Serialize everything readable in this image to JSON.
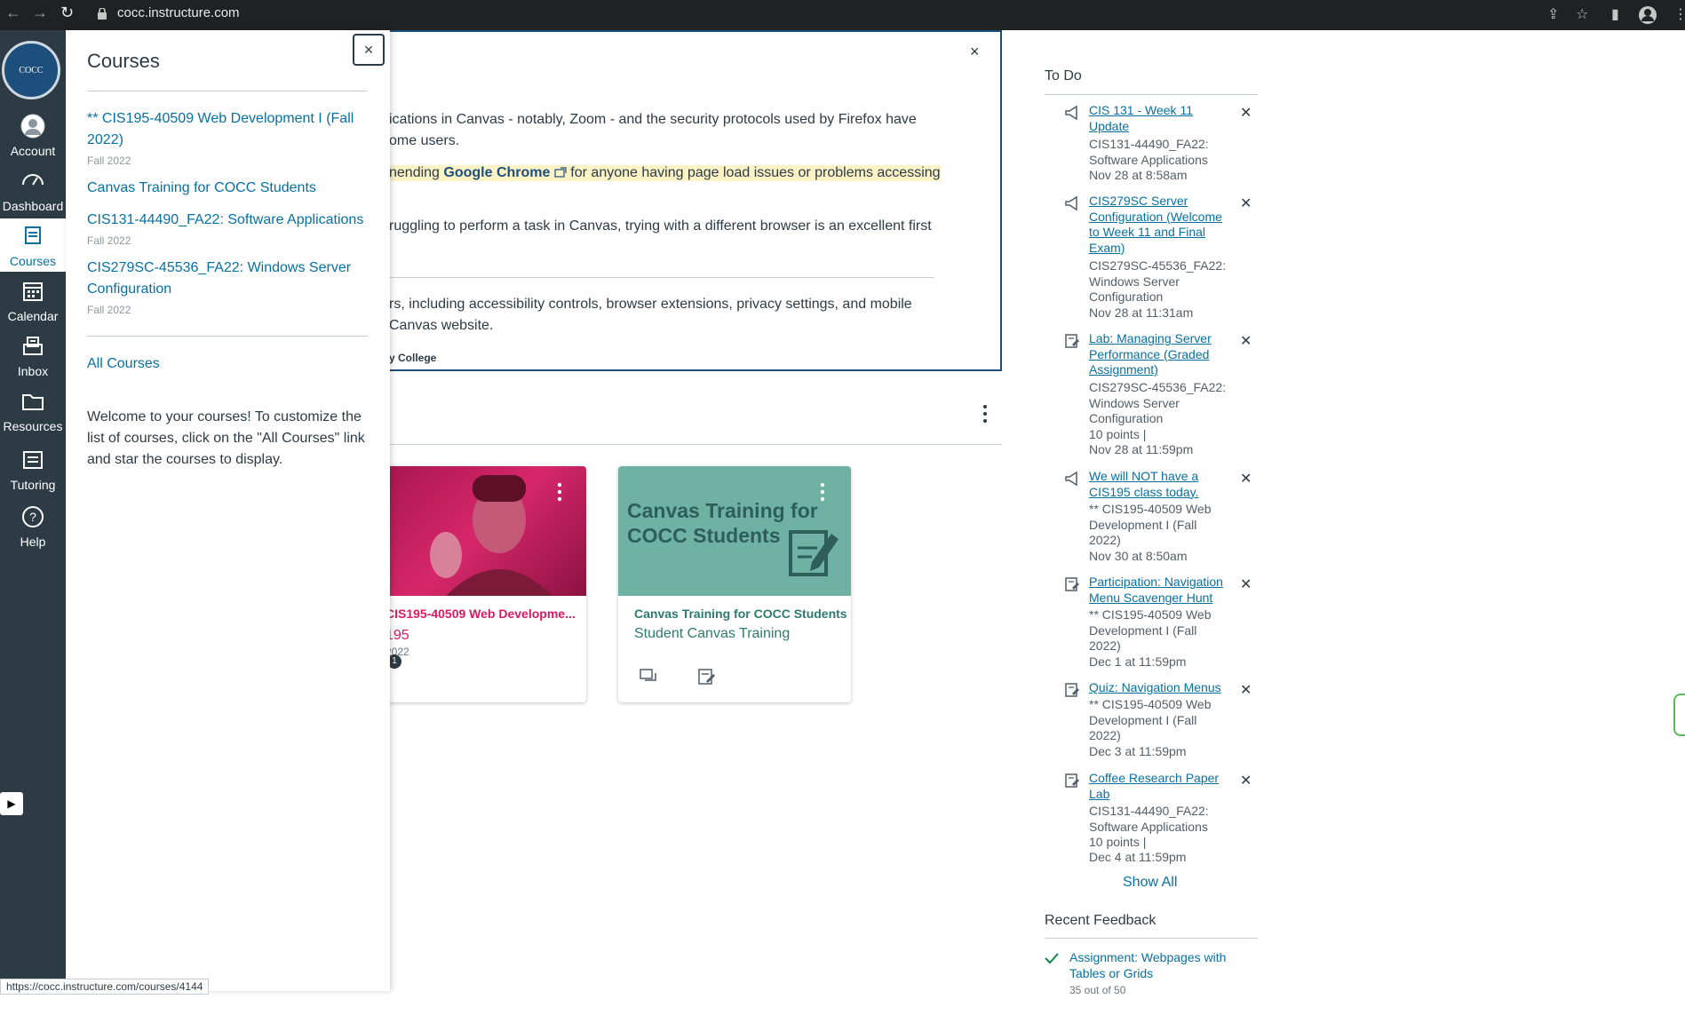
{
  "browser": {
    "url": "cocc.instructure.com",
    "status_url": "https://cocc.instructure.com/courses/4144"
  },
  "global_nav": {
    "logo_text": "COCC",
    "items": [
      {
        "label": "Account",
        "icon": "account-icon"
      },
      {
        "label": "Dashboard",
        "icon": "dashboard-icon"
      },
      {
        "label": "Courses",
        "icon": "courses-icon",
        "active": true
      },
      {
        "label": "Calendar",
        "icon": "calendar-icon"
      },
      {
        "label": "Inbox",
        "icon": "inbox-icon"
      },
      {
        "label": "Resources",
        "icon": "folder-icon"
      },
      {
        "label": "Tutoring",
        "icon": "tutoring-icon"
      },
      {
        "label": "Help",
        "icon": "help-icon"
      }
    ]
  },
  "tray": {
    "title": "Courses",
    "close_label": "×",
    "courses": [
      {
        "name": "** CIS195-40509 Web Development I (Fall 2022)",
        "term": "Fall 2022"
      },
      {
        "name": "Canvas Training for COCC Students",
        "term": ""
      },
      {
        "name": "CIS131-44490_FA22: Software Applications",
        "term": "Fall 2022"
      },
      {
        "name": "CIS279SC-45536_FA22: Windows Server Configuration",
        "term": "Fall 2022"
      }
    ],
    "all_courses": "All Courses",
    "welcome": "Welcome to your courses! To customize the list of courses, click on the \"All Courses\" link and star the courses to display."
  },
  "announcement": {
    "close_label": "×",
    "line1": "ications in Canvas - notably, Zoom - and the security protocols used by Firefox have",
    "line2": "ome users.",
    "line3_pre": "nending ",
    "line3_link": "Google Chrome",
    "line3_post": " for anyone having page load issues or problems accessing",
    "line4": "ruggling to perform a task in Canvas, trying with a different browser is an excellent first",
    "line5": "rs, including accessibility controls, browser extensions, privacy settings, and mobile",
    "line6": " Canvas website.",
    "footer": "y College"
  },
  "cards": [
    {
      "course": "CIS195-40509 Web Developme...",
      "short": "195",
      "term": "2022",
      "badge": "1",
      "color": "#d81b60"
    },
    {
      "course": "Canvas Training for COCC Students",
      "short": "Student Canvas Training",
      "hero_line1": "Canvas Training for",
      "hero_line2": "COCC Students",
      "color": "#2d7a6e"
    }
  ],
  "todo": {
    "title": "To Do",
    "items": [
      {
        "link": "CIS 131 - Week 11 Update",
        "context": "CIS131-44490_FA22: Software Applications",
        "meta": "Nov 28 at 8:58am",
        "icon": "announcement-icon"
      },
      {
        "link": "CIS279SC Server Configuration (Welcome to Week 11 and Final Exam)",
        "context": "CIS279SC-45536_FA22: Windows Server Configuration",
        "meta": "Nov 28 at 11:31am",
        "icon": "announcement-icon"
      },
      {
        "link": "Lab: Managing Server Performance (Graded Assignment)",
        "context": "CIS279SC-45536_FA22: Windows Server Configuration",
        "points": "10 points  |",
        "meta": "Nov 28 at 11:59pm",
        "icon": "assignment-icon"
      },
      {
        "link": "We will NOT have a CIS195 class today.",
        "context": "** CIS195-40509 Web Development I (Fall 2022)",
        "meta": "Nov 30 at 8:50am",
        "icon": "announcement-icon"
      },
      {
        "link": "Participation: Navigation Menu Scavenger Hunt",
        "context": "** CIS195-40509 Web Development I (Fall 2022)",
        "meta": "Dec 1 at 11:59pm",
        "icon": "assignment-icon"
      },
      {
        "link": "Quiz: Navigation Menus",
        "context": "** CIS195-40509 Web Development I (Fall 2022)",
        "meta": "Dec 3 at 11:59pm",
        "icon": "assignment-icon"
      },
      {
        "link": "Coffee Research Paper Lab",
        "context": "CIS131-44490_FA22: Software Applications",
        "points": "10 points  |",
        "meta": "Dec 4 at 11:59pm",
        "icon": "assignment-icon"
      }
    ],
    "dismiss_label": "✕",
    "show_all": "Show All"
  },
  "recent_feedback": {
    "title": "Recent Feedback",
    "item_link": "Assignment: Webpages with Tables or Grids",
    "item_sub": "35 out of 50"
  }
}
